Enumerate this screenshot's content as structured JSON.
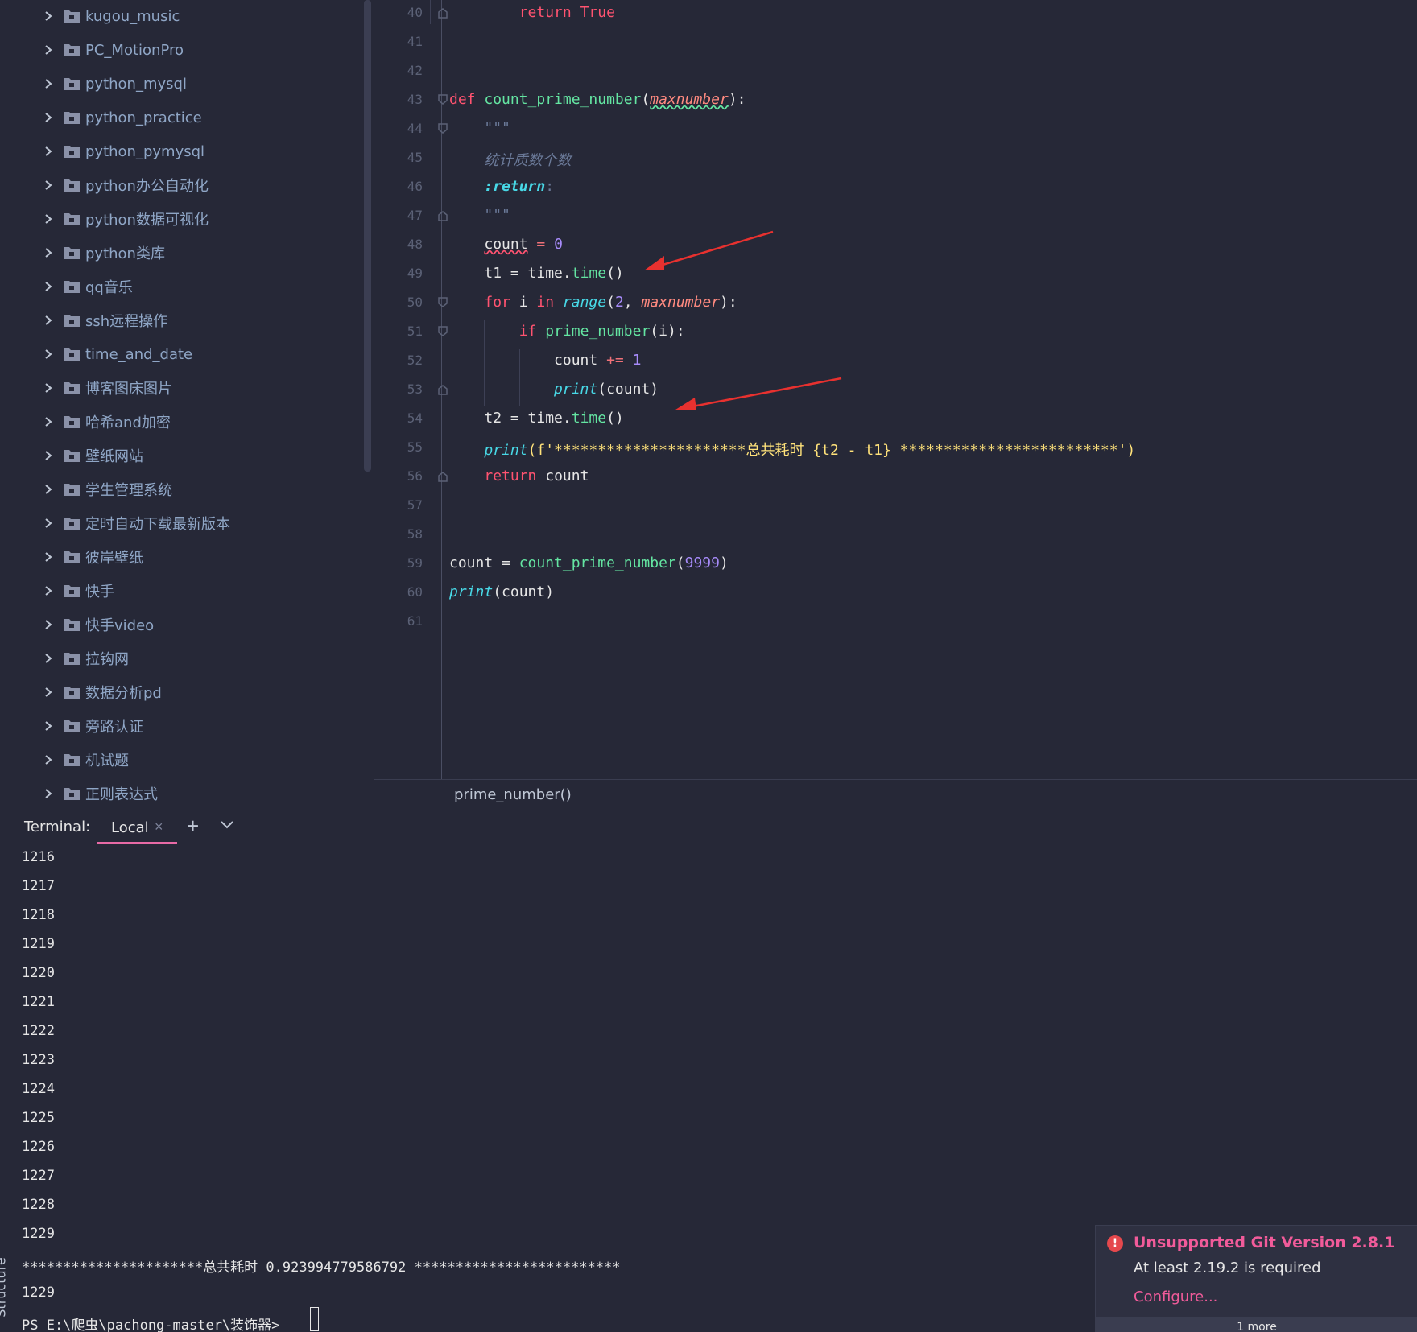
{
  "project_tree": {
    "folders": [
      "kugou_music",
      "PC_MotionPro",
      "python_mysql",
      "python_practice",
      "python_pymysql",
      "python办公自动化",
      "python数据可视化",
      "python类库",
      "qq音乐",
      "ssh远程操作",
      "time_and_date",
      "博客图床图片",
      "哈希and加密",
      "壁纸网站",
      "学生管理系统",
      "定时自动下载最新版本",
      "彼岸壁纸",
      "快手",
      "快手video",
      "拉钩网",
      "数据分析pd",
      "旁路认证",
      "机试题",
      "正则表达式"
    ]
  },
  "editor": {
    "line_numbers": [
      "40",
      "41",
      "42",
      "43",
      "44",
      "45",
      "46",
      "47",
      "48",
      "49",
      "50",
      "51",
      "52",
      "53",
      "54",
      "55",
      "56",
      "57",
      "58",
      "59",
      "60",
      "61"
    ],
    "code": {
      "l40_kw": "return",
      "l40_val": "True",
      "l43_def": "def",
      "l43_name": "count_prime_number",
      "l43_param": "maxnumber",
      "l44": "\"\"\"",
      "l45": "统计质数个数",
      "l46": ":return",
      "l46_colon": ":",
      "l47": "\"\"\"",
      "l48_var": "count",
      "l48_op": " = ",
      "l48_num": "0",
      "l49_var": "t1 = time.",
      "l49_fn": "time",
      "l49_end": "()",
      "l50_for": "for",
      "l50_i": " i ",
      "l50_in": "in",
      "l50_range": "range",
      "l50_open": "(",
      "l50_num": "2",
      "l50_comma": ", ",
      "l50_param": "maxnumber",
      "l50_end": "):",
      "l51_if": "if",
      "l51_fn": "prime_number",
      "l51_end": "(i):",
      "l52_var": "count ",
      "l52_op": "+=",
      "l52_num": "1",
      "l53_print": "print",
      "l53_end": "(count)",
      "l54_var": "t2 = time.",
      "l54_fn": "time",
      "l54_end": "()",
      "l55_print": "print",
      "l55_str": "(f'**********************总共耗时 {t2 - t1} *************************')",
      "l56_kw": "return",
      "l56_var": " count",
      "l59_var": "count = ",
      "l59_fn": "count_prime_number",
      "l59_open": "(",
      "l59_num": "9999",
      "l59_end": ")",
      "l60_print": "print",
      "l60_end": "(count)"
    },
    "breadcrumb": "prime_number()"
  },
  "terminal": {
    "title": "Terminal:",
    "tab_label": "Local",
    "tab_close": "×",
    "add_label": "+",
    "output_lines": [
      "1216",
      "1217",
      "1218",
      "1219",
      "1220",
      "1221",
      "1222",
      "1223",
      "1224",
      "1225",
      "1226",
      "1227",
      "1228",
      "1229"
    ],
    "summary_line": "**********************总共耗时 0.923994779586792 *************************",
    "result_line": "1229",
    "prompt": "PS E:\\爬虫\\pachong-master\\装饰器> "
  },
  "side_tab": "Structure",
  "notification": {
    "icon": "!",
    "title": "Unsupported Git Version 2.8.1",
    "body": "At least 2.19.2 is required",
    "link": "Configure...",
    "more": "1 more"
  },
  "colors": {
    "background": "#262837",
    "accent_pink": "#f15b9a",
    "error_red": "#e5484d",
    "arrow_red": "#e8312f"
  },
  "icons": {
    "tree_chevron": "chevron-right-icon",
    "tree_folder": "folder-icon",
    "fold_marker": "fold-icon",
    "terminal_more": "chevron-down-icon",
    "notification": "error-icon"
  }
}
